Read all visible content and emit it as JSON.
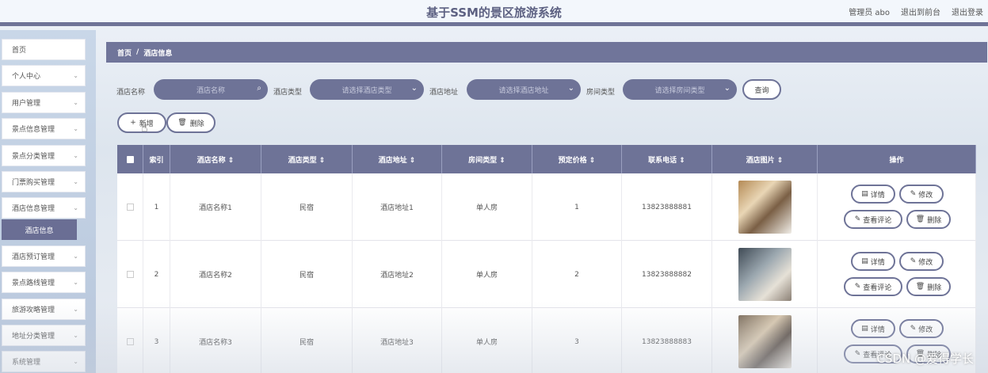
{
  "header": {
    "title": "基于SSM的景区旅游系统",
    "admin": "管理员 abo",
    "front_link": "退出到前台",
    "logout_link": "退出登录"
  },
  "sidebar": {
    "items": [
      {
        "label": "首页",
        "chevron": false
      },
      {
        "label": "个人中心",
        "chevron": true
      },
      {
        "label": "用户管理",
        "chevron": true
      },
      {
        "label": "景点信息管理",
        "chevron": true
      },
      {
        "label": "景点分类管理",
        "chevron": true
      },
      {
        "label": "门票购买管理",
        "chevron": true
      },
      {
        "label": "酒店信息管理",
        "chevron": true
      },
      {
        "label": "酒店预订管理",
        "chevron": true
      },
      {
        "label": "景点路线管理",
        "chevron": true
      },
      {
        "label": "旅游攻略管理",
        "chevron": true
      },
      {
        "label": "地址分类管理",
        "chevron": true
      },
      {
        "label": "系统管理",
        "chevron": true
      }
    ],
    "active_sub": "酒店信息"
  },
  "breadcrumb": {
    "home": "首页",
    "sep": "/",
    "current": "酒店信息"
  },
  "filters": {
    "name_label": "酒店名称",
    "name_placeholder": "酒店名称",
    "type_label": "酒店类型",
    "type_placeholder": "请选择酒店类型",
    "addr_label": "酒店地址",
    "addr_placeholder": "请选择酒店地址",
    "room_label": "房间类型",
    "room_placeholder": "请选择房间类型",
    "search_button": "查询"
  },
  "actions": {
    "add": "新增",
    "delete": "删除"
  },
  "table": {
    "headers": [
      "索引",
      "酒店名称 ⇕",
      "酒店类型 ⇕",
      "酒店地址 ⇕",
      "房间类型 ⇕",
      "预定价格 ⇕",
      "联系电话 ⇕",
      "酒店图片 ⇕",
      "操作"
    ],
    "rows": [
      {
        "index": "1",
        "name": "酒店名称1",
        "type": "民宿",
        "addr": "酒店地址1",
        "room": "单人房",
        "price": "1",
        "phone": "13823888881"
      },
      {
        "index": "2",
        "name": "酒店名称2",
        "type": "民宿",
        "addr": "酒店地址2",
        "room": "单人房",
        "price": "2",
        "phone": "13823888882"
      },
      {
        "index": "3",
        "name": "酒店名称3",
        "type": "民宿",
        "addr": "酒店地址3",
        "room": "单人房",
        "price": "3",
        "phone": "13823888883"
      }
    ],
    "row_buttons": {
      "detail": "详情",
      "edit": "修改",
      "comments": "查看评论",
      "delete": "删除"
    }
  },
  "watermark": "CSDN @爱得学长",
  "colors": {
    "accent": "#6e7397",
    "header_bg": "#f3f7fc"
  }
}
